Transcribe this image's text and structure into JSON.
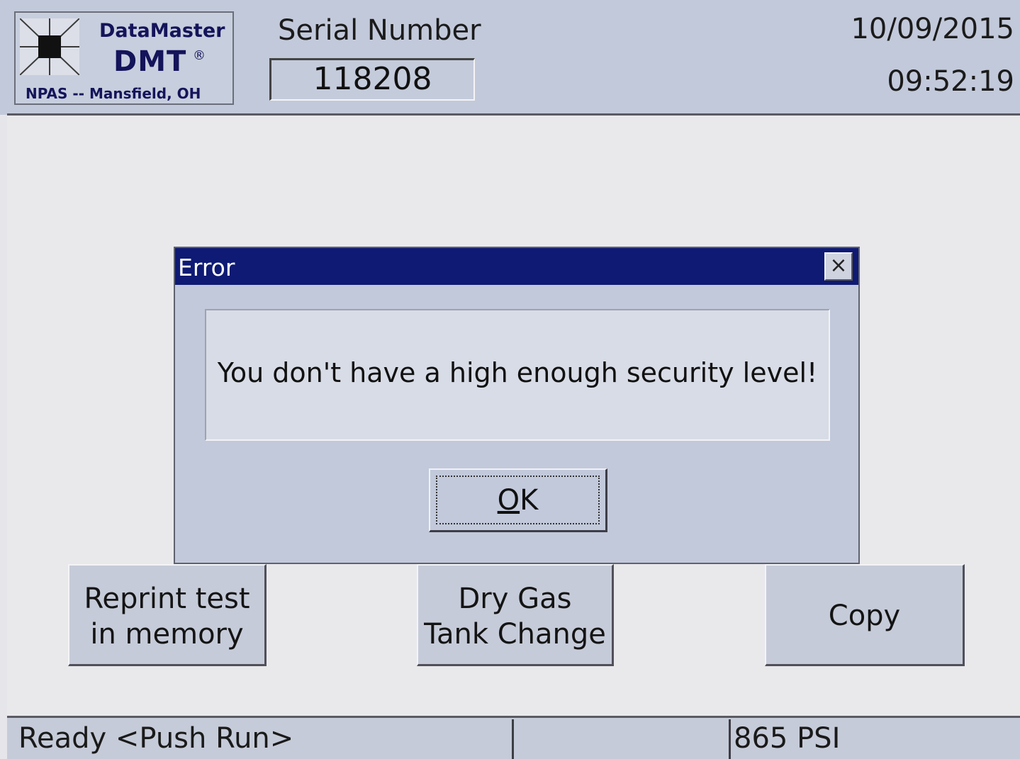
{
  "header": {
    "logo": {
      "brand": "DataMaster",
      "model": "DMT",
      "registered": "®",
      "location": "NPAS -- Mansfield, OH"
    },
    "serial_label": "Serial Number",
    "serial_value": "118208",
    "date": "10/09/2015",
    "time": "09:52:19"
  },
  "dialog": {
    "title": "Error",
    "close_glyph": "×",
    "message": "You don't have a high enough security level!",
    "ok_label_underlined": "O",
    "ok_label_rest": "K"
  },
  "buttons": {
    "reprint_line1": "Reprint test",
    "reprint_line2": "in memory",
    "drygas_line1": "Dry Gas",
    "drygas_line2": "Tank Change",
    "copy": "Copy"
  },
  "status": {
    "message": "Ready <Push Run>",
    "middle": "",
    "pressure": "865 PSI"
  },
  "colors": {
    "titlebar": "#0e1a73",
    "panel": "#c2c9db",
    "background": "#e9e9ec"
  },
  "icons": {
    "logo": "datamaster-logo-icon",
    "close": "close-icon"
  }
}
